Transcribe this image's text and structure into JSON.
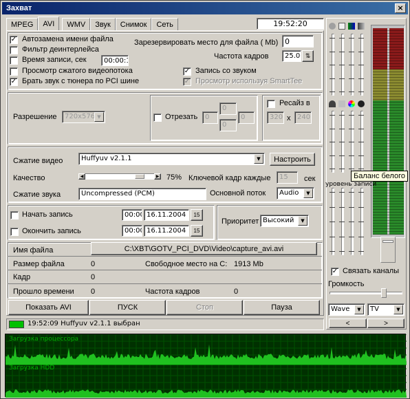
{
  "window": {
    "title": "Захват",
    "close_glyph": "×"
  },
  "clock": "19:52:20",
  "tabs": [
    "MPEG",
    "AVI",
    "WMV",
    "Звук",
    "Снимок",
    "Сеть"
  ],
  "options": {
    "auto_rename": "Автозамена имени файла",
    "deinterlace": "Фильтр деинтерлейса",
    "rec_time": "Время записи, сек",
    "rec_time_value": "00:00:10",
    "preview_compressed": "Просмотр сжатого видеопотока",
    "tuner_audio": "Брать звук с тюнера по PCI шине",
    "reserve_label": "Зарезервировать место для файла ( Mb)",
    "reserve_value": "0",
    "framerate_label": "Частота кадров",
    "framerate_value": "25.00",
    "record_audio": "Запись со звуком",
    "smarttee": "Просмотр используя SmartTee"
  },
  "resolution": {
    "label": "Разрешение",
    "value": "720x576",
    "crop_label": "Отрезать",
    "crop": [
      "0",
      "0",
      "0",
      "0"
    ],
    "resize_label": "Ресайз в",
    "resize_w": "320",
    "resize_x": "x",
    "resize_h": "240"
  },
  "compression": {
    "video_label": "Сжатие видео",
    "video_codec": "Huffyuv v2.1.1",
    "configure": "Настроить",
    "quality_label": "Качество",
    "quality_value": 75,
    "quality_text": "75%",
    "keyframe_label": "Ключевой кадр каждые",
    "keyframe_value": "15",
    "keyframe_unit": "сек",
    "audio_label": "Сжатие звука",
    "audio_codec": "Uncompressed (PCM)",
    "main_stream_label": "Основной поток",
    "main_stream_value": "Audio"
  },
  "schedule": {
    "start_label": "Начать запись",
    "start_time": "00:00",
    "start_date": "16.11.2004",
    "stop_label": "Окончить запись",
    "stop_time": "00:00",
    "stop_date": "16.11.2004",
    "cal_glyph": "15",
    "priority_label": "Приоритет",
    "priority_value": "Высокий"
  },
  "info": {
    "filename_label": "Имя файла",
    "filename": "C:\\XBT\\GOTV_PCI_DVD\\Video\\capture_avi.avi",
    "size_label": "Размер файла",
    "size_value": "0",
    "free_label": "Свободное место на C:",
    "free_value": "1913 Mb",
    "frame_label": "Кадр",
    "frame_value": "0",
    "elapsed_label": "Прошло времени",
    "elapsed_value": "0",
    "fps_label": "Частота кадров",
    "fps_value": "0"
  },
  "actions": {
    "show": "Показать AVI",
    "start": "ПУСК",
    "stop": "Стоп",
    "pause": "Пауза"
  },
  "status": {
    "text": "19:52:09  Huffyuv v2.1.1 выбран"
  },
  "mixer": {
    "tooltip": "Баланс белого",
    "rec_level": "уровень записи",
    "link_channels": "Связать каналы",
    "volume": "Громкость",
    "source1": "Wave",
    "source2": "TV",
    "prev": "<",
    "next": ">"
  },
  "graphs": {
    "cpu": "Загрузка процессора",
    "hdd": "Загрузка HDD"
  },
  "colors": {
    "accent_green": "#00c000",
    "graph_bg": "#003000",
    "title_bar": "#0a246a"
  }
}
